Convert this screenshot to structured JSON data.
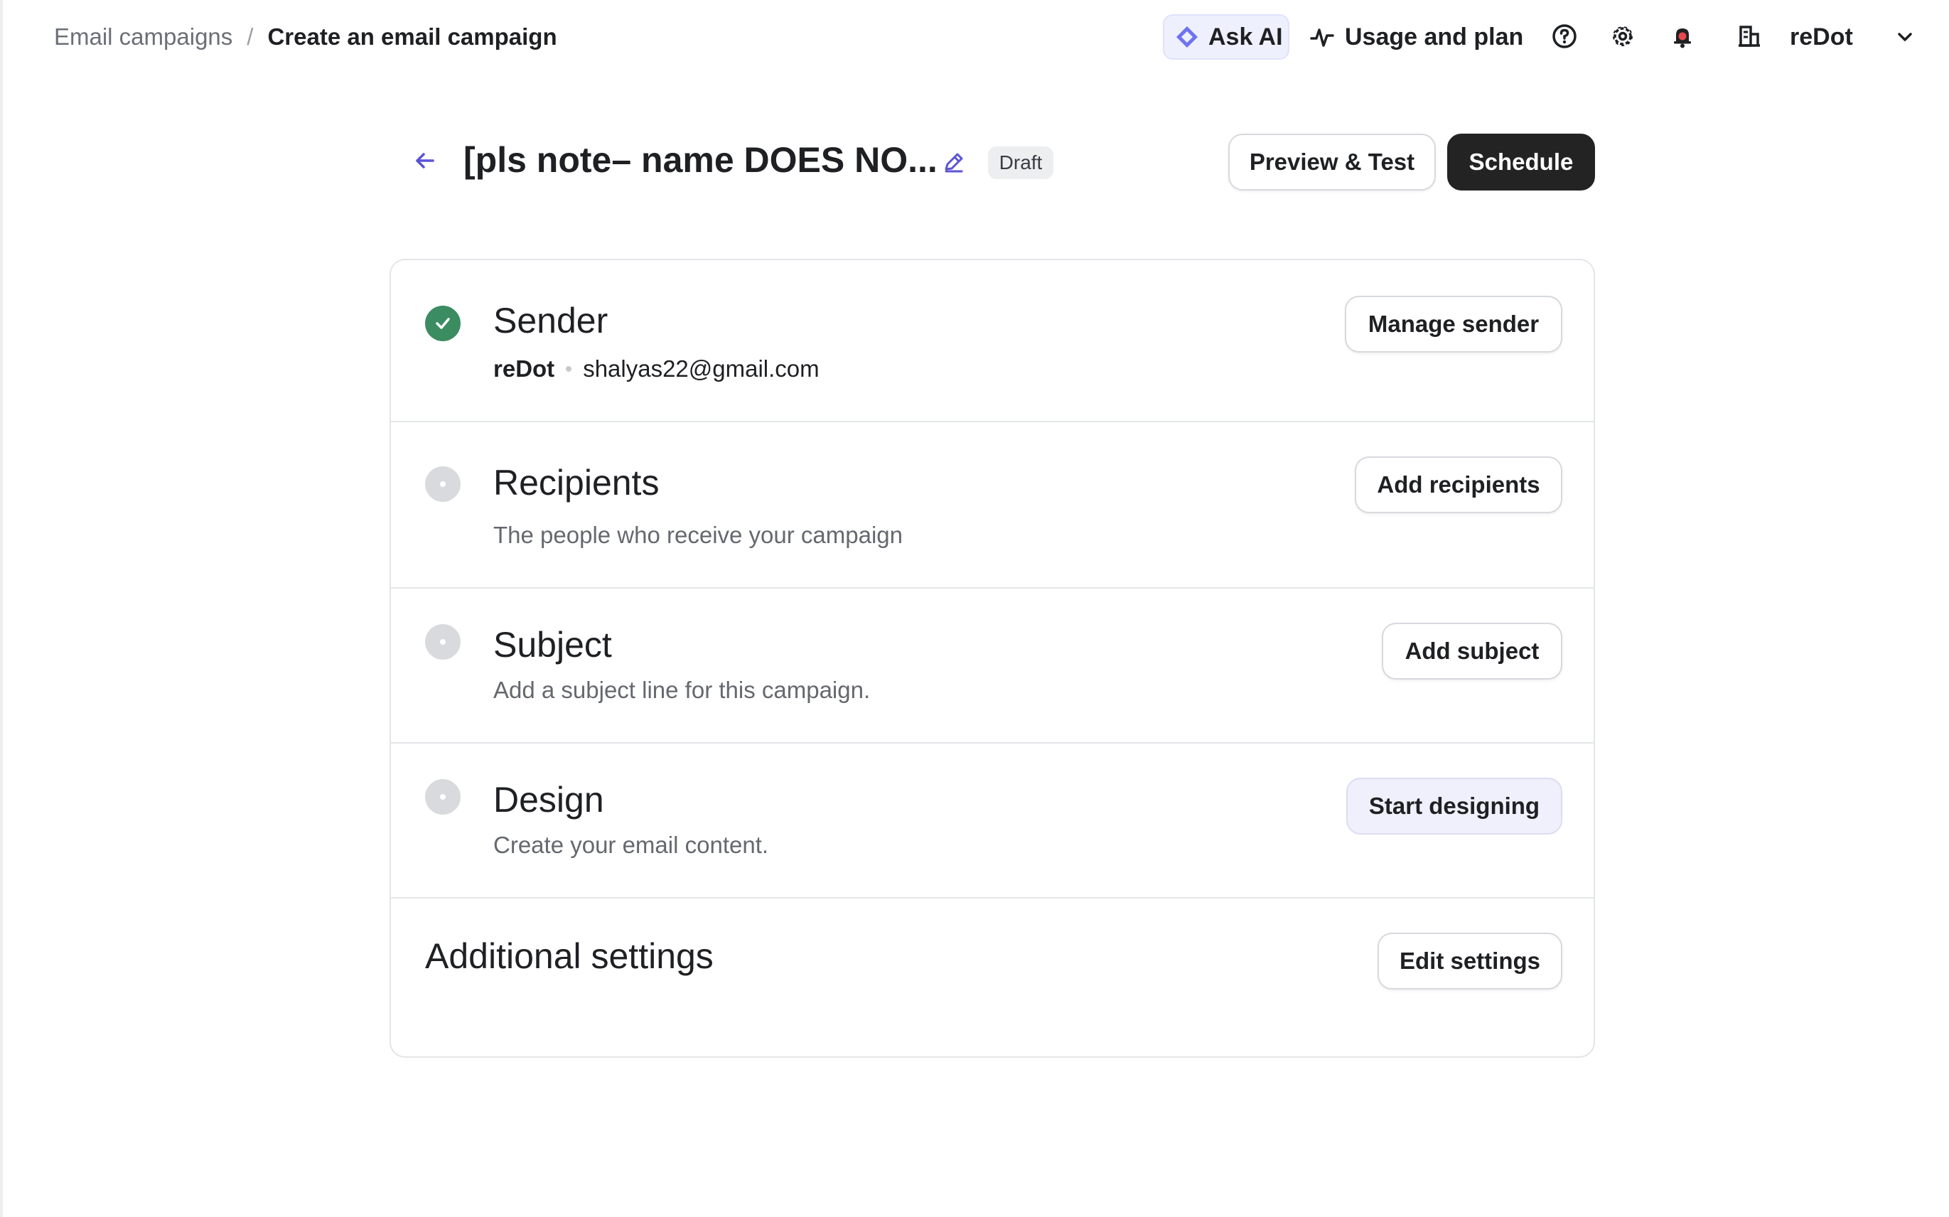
{
  "breadcrumb": {
    "parent": "Email campaigns",
    "separator": "/",
    "current": "Create an email campaign"
  },
  "topnav": {
    "ask_ai": "Ask AI",
    "usage": "Usage and plan",
    "account": "reDot",
    "icons": [
      "help-icon",
      "settings-icon",
      "bell-icon",
      "building-icon",
      "chevron-down-icon"
    ]
  },
  "campaign": {
    "title": "[pls note– name DOES NO...",
    "status": "Draft",
    "preview_label": "Preview & Test",
    "schedule_label": "Schedule"
  },
  "sections": {
    "sender": {
      "title": "Sender",
      "name": "reDot",
      "email": "shalyas22@gmail.com",
      "action": "Manage sender",
      "complete": true
    },
    "recipients": {
      "title": "Recipients",
      "description": "The people who receive your campaign",
      "action": "Add recipients",
      "complete": false
    },
    "subject": {
      "title": "Subject",
      "description": "Add a subject line for this campaign.",
      "action": "Add subject",
      "complete": false
    },
    "design": {
      "title": "Design",
      "description": "Create your email content.",
      "action": "Start designing",
      "complete": false
    },
    "additional": {
      "title": "Additional settings",
      "action": "Edit settings"
    }
  },
  "colors": {
    "accent": "#5b54d6",
    "success": "#3c8c62",
    "primary_button": "#232323",
    "notification_dot": "#e5484d"
  }
}
